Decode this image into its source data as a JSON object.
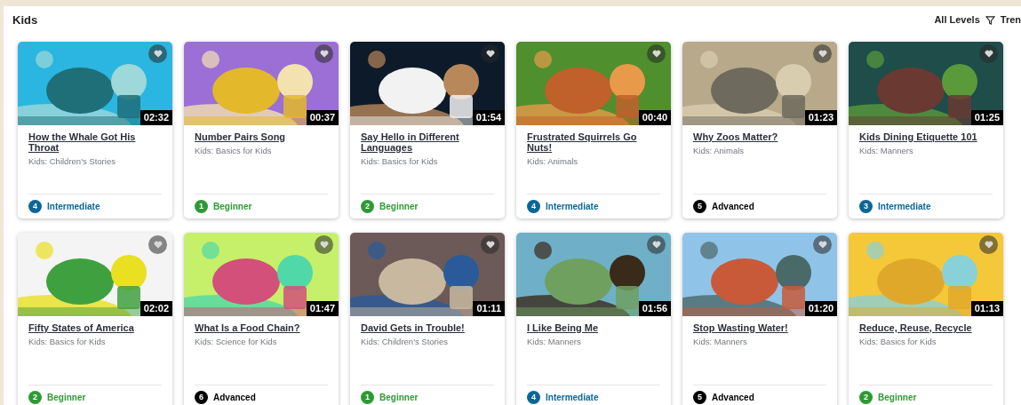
{
  "section": {
    "title": "Kids"
  },
  "controls": {
    "level_filter": "All Levels",
    "sort": "Tren"
  },
  "videos": [
    {
      "title": "How the Whale Got His Throat",
      "category": "Kids: Children's Stories",
      "duration": "02:32",
      "level_number": "4",
      "level": "Intermediate",
      "kind": "intermediate"
    },
    {
      "title": "Number Pairs Song",
      "category": "Kids: Basics for Kids",
      "duration": "00:37",
      "level_number": "1",
      "level": "Beginner",
      "kind": "beginner"
    },
    {
      "title": "Say Hello in Different Languages",
      "category": "Kids: Basics for Kids",
      "duration": "01:54",
      "level_number": "2",
      "level": "Beginner",
      "kind": "beginner"
    },
    {
      "title": "Frustrated Squirrels Go Nuts!",
      "category": "Kids: Animals",
      "duration": "00:40",
      "level_number": "4",
      "level": "Intermediate",
      "kind": "intermediate"
    },
    {
      "title": "Why Zoos Matter?",
      "category": "Kids: Animals",
      "duration": "01:23",
      "level_number": "5",
      "level": "Advanced",
      "kind": "advanced"
    },
    {
      "title": "Kids Dining Etiquette 101",
      "category": "Kids: Manners",
      "duration": "01:25",
      "level_number": "3",
      "level": "Intermediate",
      "kind": "intermediate"
    },
    {
      "title": "Fifty States of America",
      "category": "Kids: Basics for Kids",
      "duration": "02:02",
      "level_number": "2",
      "level": "Beginner",
      "kind": "beginner"
    },
    {
      "title": "What Is a Food Chain?",
      "category": "Kids: Science for Kids",
      "duration": "01:47",
      "level_number": "6",
      "level": "Advanced",
      "kind": "advanced"
    },
    {
      "title": "David Gets in Trouble!",
      "category": "Kids: Children's Stories",
      "duration": "01:11",
      "level_number": "1",
      "level": "Beginner",
      "kind": "beginner"
    },
    {
      "title": "I Like Being Me",
      "category": "Kids: Manners",
      "duration": "01:56",
      "level_number": "4",
      "level": "Intermediate",
      "kind": "intermediate"
    },
    {
      "title": "Stop Wasting Water!",
      "category": "Kids: Manners",
      "duration": "01:20",
      "level_number": "5",
      "level": "Advanced",
      "kind": "advanced"
    },
    {
      "title": "Reduce, Reuse, Recycle",
      "category": "Kids: Basics for Kids",
      "duration": "01:13",
      "level_number": "2",
      "level": "Beginner",
      "kind": "beginner"
    }
  ]
}
